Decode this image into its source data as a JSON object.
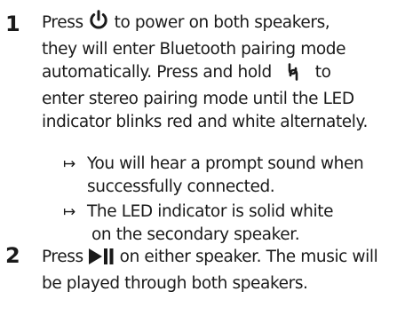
{
  "steps": [
    {
      "number": "1",
      "lines": [
        "Press",
        "to power on both speakers,",
        "they will enter Bluetooth pairing mode",
        "automatically.  Press and hold",
        "to",
        "enter stereo pairing mode until the LED",
        "indicator blinks red and white alternately."
      ],
      "icons": [
        "power-icon",
        "link-icon"
      ],
      "results": [
        {
          "arrow": "↦",
          "lines": [
            "You will hear a prompt sound when",
            "successfully connected."
          ]
        },
        {
          "arrow": "↦",
          "lines": [
            "The LED indicator is solid white",
            "on the secondary speaker."
          ]
        }
      ]
    },
    {
      "number": "2",
      "lines": [
        "Press",
        "on either speaker. The music will",
        "be played through both speakers."
      ],
      "icons": [
        "play-pause-icon"
      ]
    }
  ]
}
